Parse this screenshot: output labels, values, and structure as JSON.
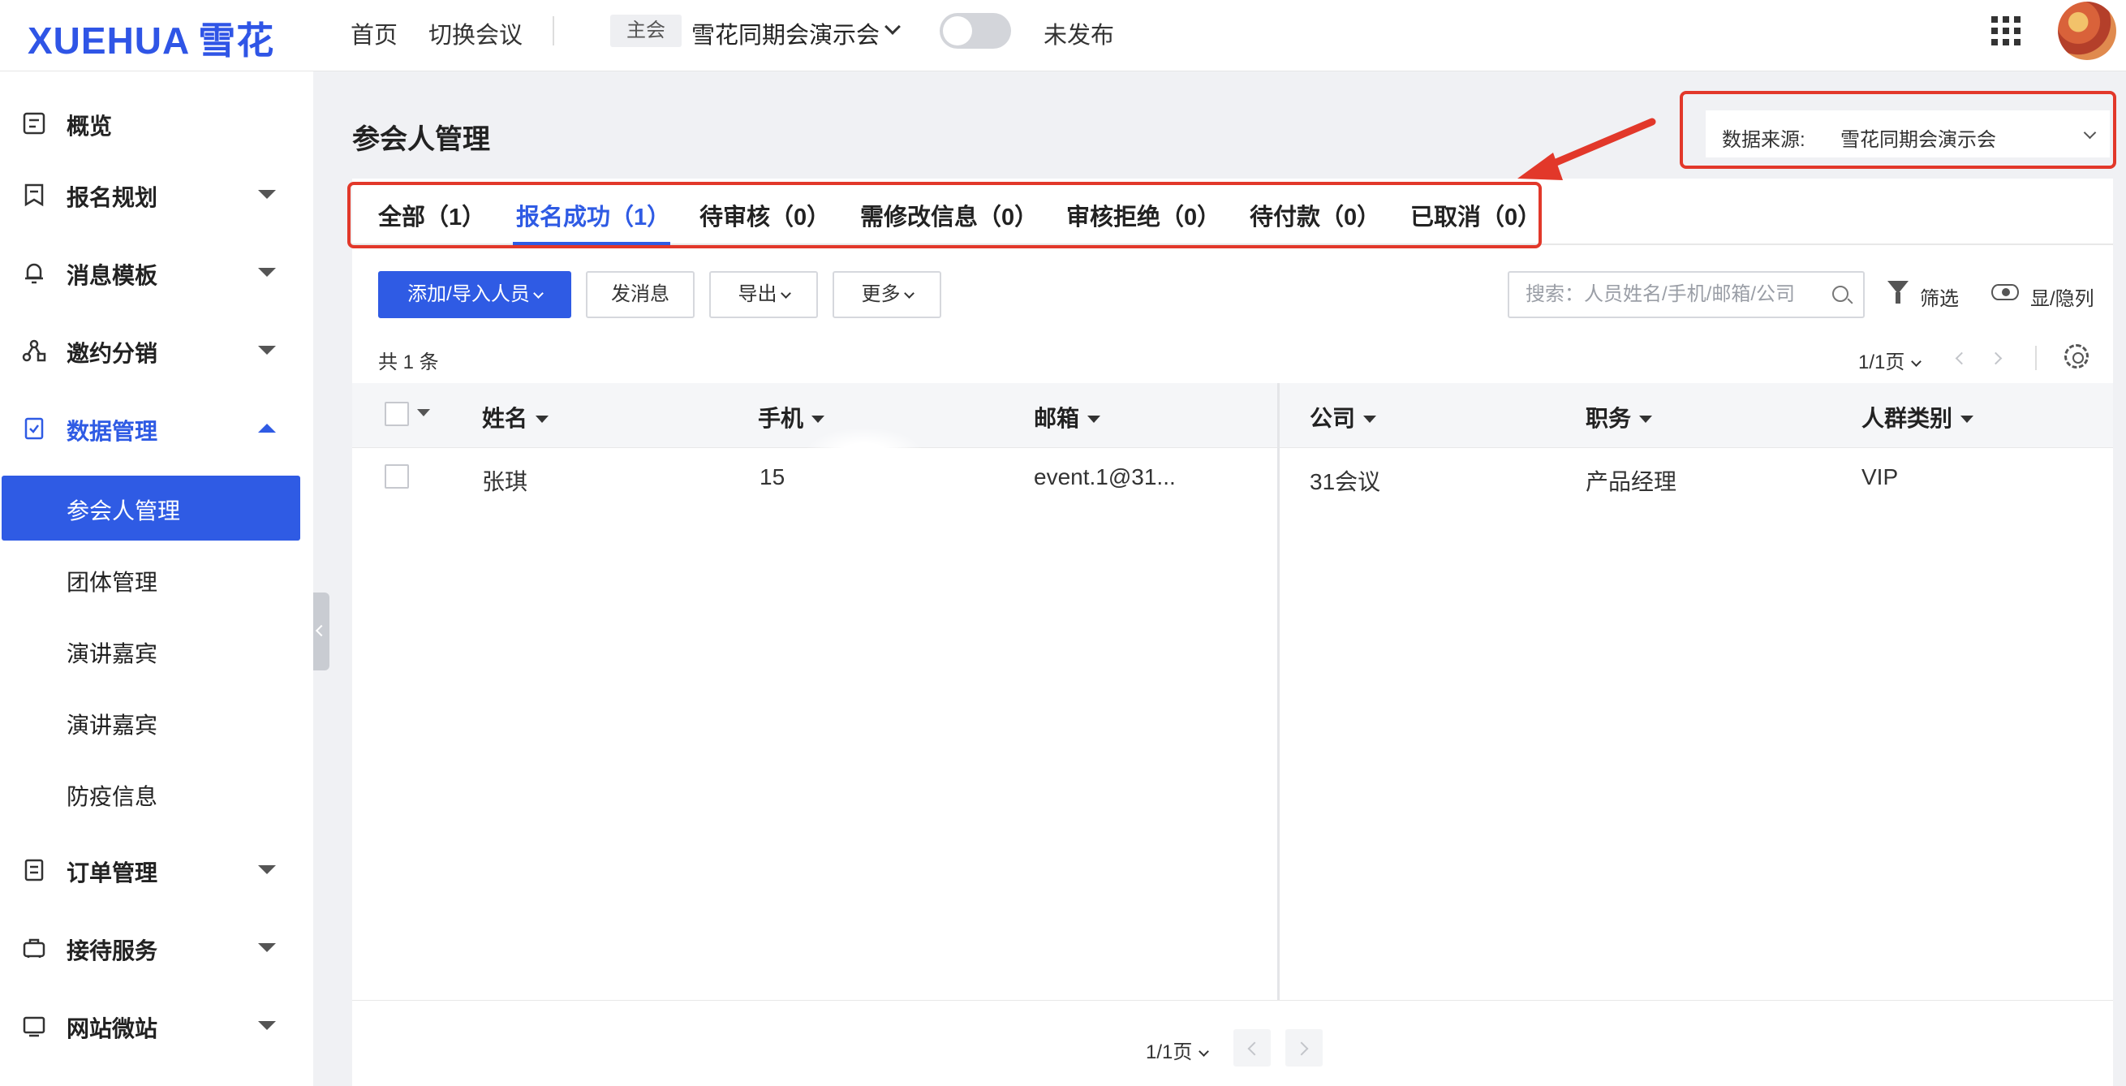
{
  "header": {
    "logo_en": "XUEHUA",
    "logo_cn": "雪花",
    "nav": [
      "首页",
      "切换会议"
    ],
    "tag": "主会",
    "conference": "雪花同期会演示会",
    "publish_status": "未发布",
    "toggle_on": false
  },
  "sidebar": {
    "items": [
      {
        "label": "概览",
        "icon": "overview-icon"
      },
      {
        "label": "报名规划",
        "icon": "registration-icon"
      },
      {
        "label": "消息模板",
        "icon": "bell-icon"
      },
      {
        "label": "邀约分销",
        "icon": "share-icon"
      },
      {
        "label": "数据管理",
        "icon": "data-icon"
      },
      {
        "label": "订单管理",
        "icon": "order-icon"
      },
      {
        "label": "接待服务",
        "icon": "reception-icon"
      },
      {
        "label": "网站微站",
        "icon": "website-icon"
      }
    ],
    "sub_items": [
      "参会人管理",
      "团体管理",
      "演讲嘉宾",
      "演讲嘉宾",
      "防疫信息"
    ]
  },
  "main": {
    "page_title": "参会人管理",
    "data_source": {
      "label": "数据来源:",
      "value": "雪花同期会演示会"
    },
    "tabs": [
      "全部（1）",
      "报名成功（1）",
      "待审核（0）",
      "需修改信息（0）",
      "审核拒绝（0）",
      "待付款（0）",
      "已取消（0）"
    ],
    "active_tab": 1,
    "toolbar": {
      "add_import": "添加/导入人员",
      "send_message": "发消息",
      "export": "导出",
      "more": "更多",
      "search_placeholder": "搜索：人员姓名/手机/邮箱/公司",
      "filter": "筛选",
      "toggle_columns": "显/隐列"
    },
    "total": "共 1 条",
    "pager": "1/1页",
    "table": {
      "headers": [
        "姓名",
        "手机",
        "邮箱",
        "公司",
        "职务",
        "人群类别"
      ],
      "rows": [
        [
          "张琪",
          "15",
          "event.1@31...",
          "31会议",
          "产品经理",
          "VIP"
        ]
      ]
    }
  },
  "colors": {
    "primary": "#2f5be4",
    "highlight": "#e2382a"
  }
}
